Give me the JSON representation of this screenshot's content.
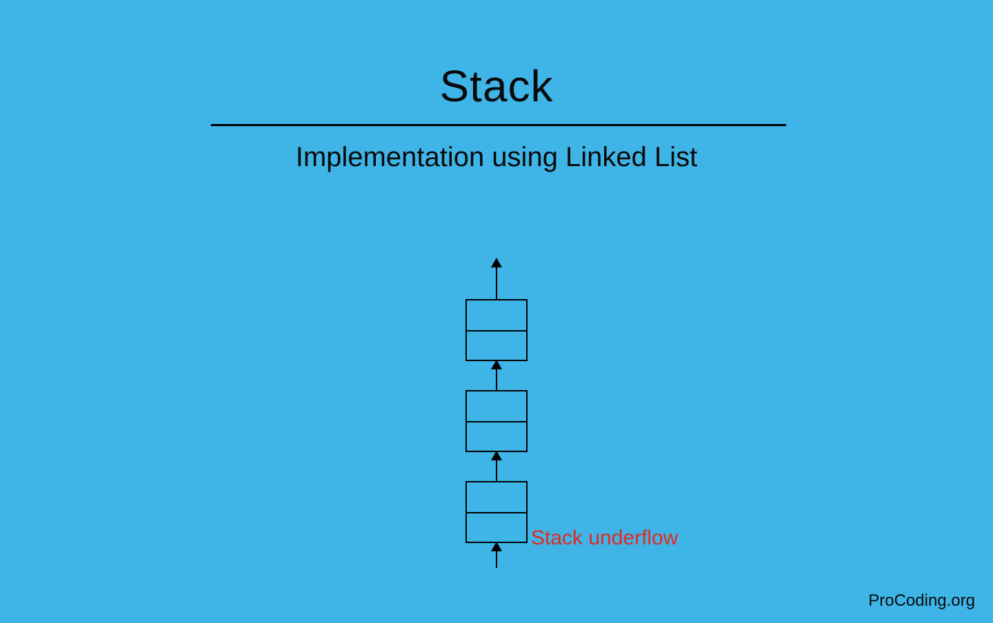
{
  "title": "Stack",
  "subtitle": "Implementation using Linked List",
  "underflow_label": "Stack underflow",
  "watermark": "ProCoding.org",
  "nodes_count": 3
}
